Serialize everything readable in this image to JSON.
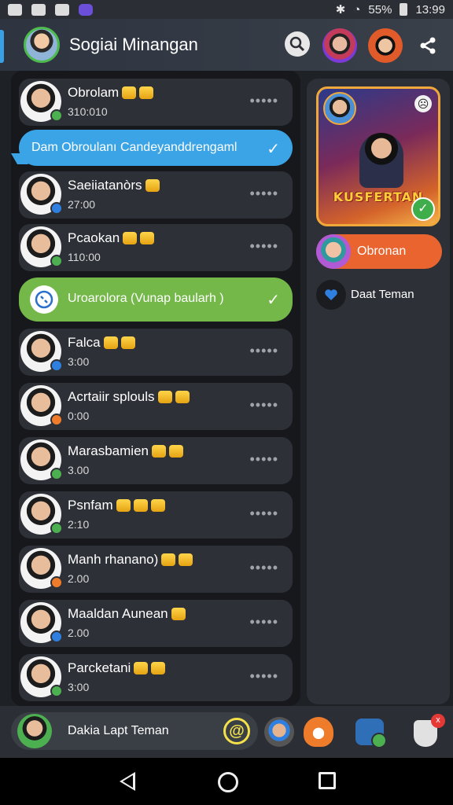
{
  "status_bar": {
    "signal_text": "55%",
    "time": "13:99"
  },
  "header": {
    "title": "Sogiai Minangan"
  },
  "chats": [
    {
      "name": "Obrolam",
      "time": "310:010",
      "crowns": 2,
      "badge": "green"
    },
    {
      "name": "Saeiiatanòrs",
      "time": "27:00",
      "crowns": 1,
      "badge": "blue"
    },
    {
      "name": "Pcaokan",
      "time": "110:00",
      "crowns": 2,
      "badge": "green"
    },
    {
      "name": "Falca",
      "time": "3:00",
      "crowns": 2,
      "badge": "blue"
    },
    {
      "name": "Acrtaiir splouls",
      "time": "0:00",
      "crowns": 2,
      "badge": "orange"
    },
    {
      "name": "Marasbamien",
      "time": "3.00",
      "crowns": 2,
      "badge": "green"
    },
    {
      "name": "Psnfam",
      "time": "2:10",
      "crowns": 3,
      "badge": "green"
    },
    {
      "name": "Manh rhanano)",
      "time": "2.00",
      "crowns": 2,
      "badge": "orange"
    },
    {
      "name": "Maaldan Aunean",
      "time": "2.00",
      "crowns": 1,
      "badge": "blue"
    },
    {
      "name": "Parcketani",
      "time": "3:00",
      "crowns": 2,
      "badge": "green"
    }
  ],
  "banners": {
    "blue": "Dam Obroulanı Candeyanddrengaml",
    "green": "Uroarolora (Vunap baularh )"
  },
  "right_panel": {
    "card_title": "KUSFERTAN",
    "pill_label": "Obronan",
    "heart_label": "Daat Teman"
  },
  "bottom_bar": {
    "compose_label": "Dakia Lapt Teman",
    "at_symbol": "@"
  },
  "colors": {
    "accent_blue": "#3aa4e6",
    "accent_green": "#73b848",
    "accent_orange": "#e9642e",
    "crown_gold": "#ffd54a"
  }
}
